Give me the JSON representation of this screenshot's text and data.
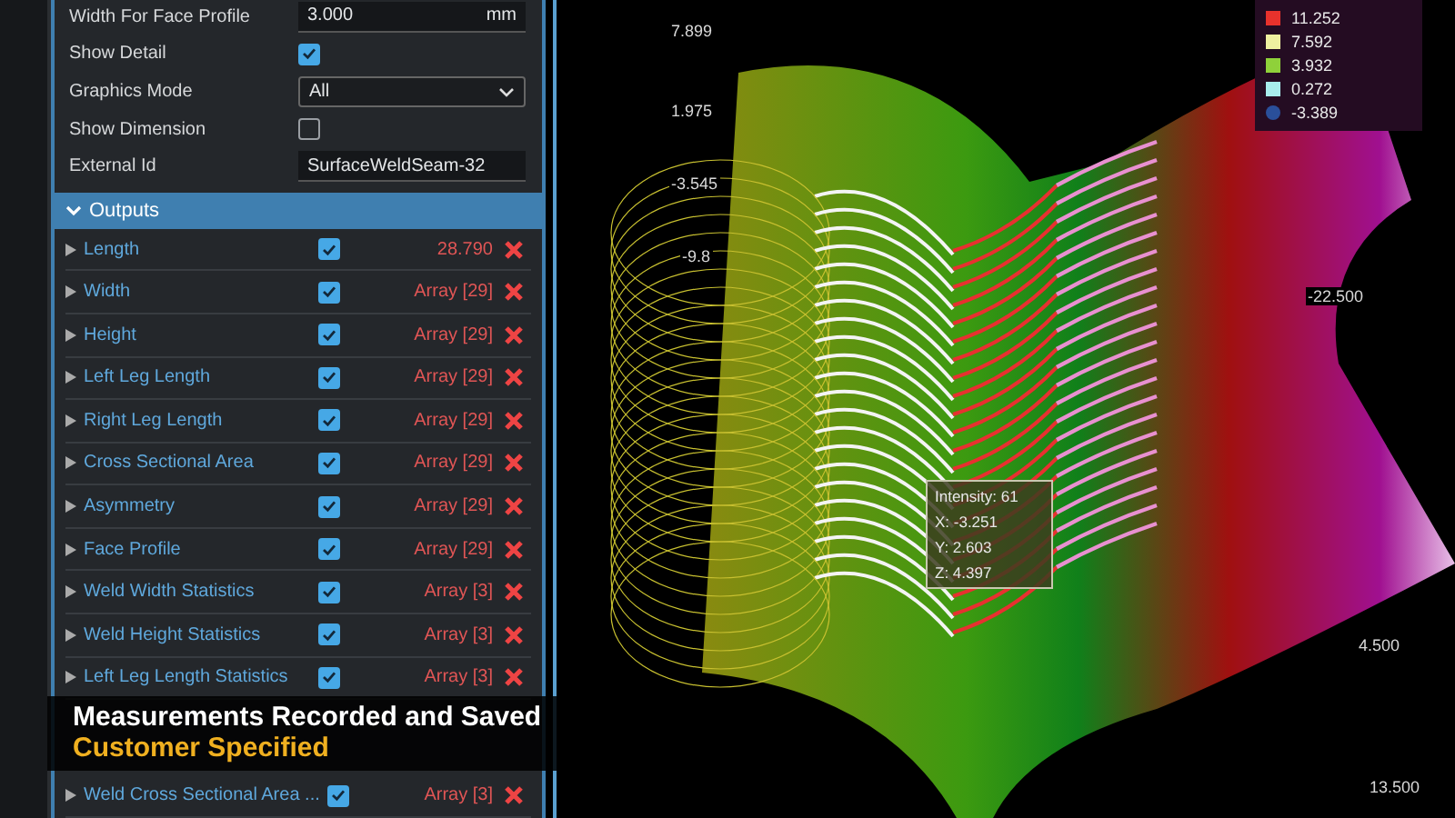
{
  "properties": [
    {
      "label": "Width For Face Profile",
      "kind": "number",
      "value": "3.000",
      "unit": "mm"
    },
    {
      "label": "Show Detail",
      "kind": "checkbox",
      "checked": true
    },
    {
      "label": "Graphics Mode",
      "kind": "dropdown",
      "value": "All"
    },
    {
      "label": "Show Dimension",
      "kind": "checkbox",
      "checked": false
    },
    {
      "label": "External Id",
      "kind": "text",
      "value": "SurfaceWeldSeam-32"
    }
  ],
  "outputs": {
    "title": "Outputs",
    "expanded": true,
    "rows": [
      {
        "name": "Length",
        "checked": true,
        "value": "28.790"
      },
      {
        "name": "Width",
        "checked": true,
        "value": "Array [29]"
      },
      {
        "name": "Height",
        "checked": true,
        "value": "Array [29]"
      },
      {
        "name": "Left Leg Length",
        "checked": true,
        "value": "Array [29]"
      },
      {
        "name": "Right Leg Length",
        "checked": true,
        "value": "Array [29]"
      },
      {
        "name": "Cross Sectional Area",
        "checked": true,
        "value": "Array [29]"
      },
      {
        "name": "Asymmetry",
        "checked": true,
        "value": "Array [29]"
      },
      {
        "name": "Face Profile",
        "checked": true,
        "value": "Array [29]"
      },
      {
        "name": "Weld Width Statistics",
        "checked": true,
        "value": "Array [3]"
      },
      {
        "name": "Weld Height Statistics",
        "checked": true,
        "value": "Array [3]"
      },
      {
        "name": "Left Leg Length Statistics",
        "checked": true,
        "value": "Array [3]"
      },
      {
        "name": "Weld Cross Sectional Area ...",
        "checked": true,
        "value": "Array [3]"
      }
    ]
  },
  "viewer": {
    "axis_labels": [
      "7.899",
      "1.975",
      "-3.545",
      "-9.8",
      "-22.500",
      "4.500",
      "13.500"
    ],
    "legend": [
      {
        "label": "11.252",
        "color": "#e8322c",
        "kind": "square"
      },
      {
        "label": "7.592",
        "color": "#eef0a0",
        "kind": "square"
      },
      {
        "label": "3.932",
        "color": "#8fd13a",
        "kind": "square"
      },
      {
        "label": "0.272",
        "color": "#a8ecec",
        "kind": "square"
      },
      {
        "label": "-3.389",
        "color": "#2a4f9a",
        "kind": "circle"
      }
    ],
    "tooltip": [
      "Intensity: 61",
      "X: -3.251",
      "Y: 2.603",
      "Z: 4.397"
    ]
  },
  "caption": {
    "line_1": "Measurements Recorded and Saved",
    "line_2": "Customer Specified"
  }
}
